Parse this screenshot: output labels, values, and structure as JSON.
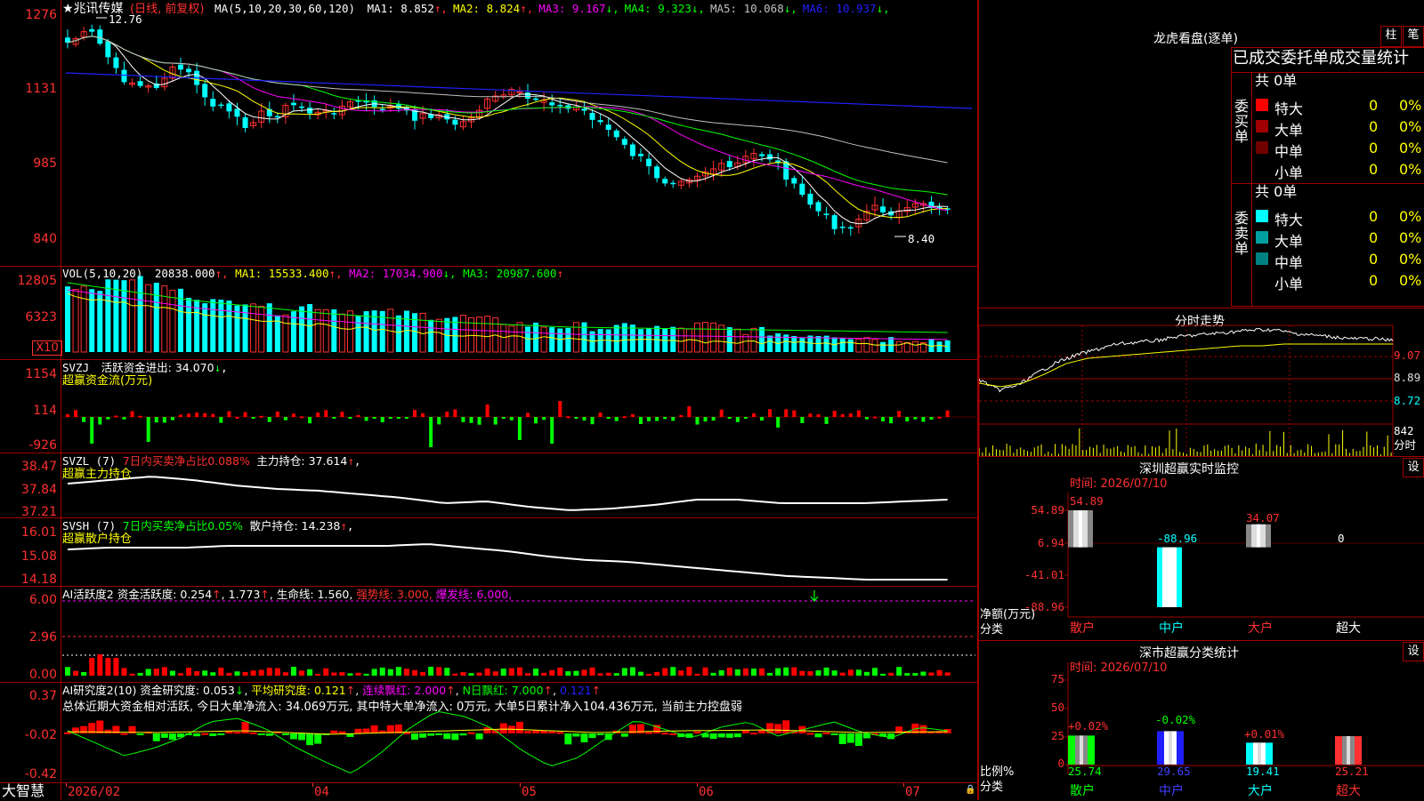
{
  "main": {
    "title": "★兆讯传媒",
    "mode": "(日线, 前复权)",
    "ma_label": "MA(5,10,20,30,60,120)",
    "ma_values": [
      {
        "label": "MA1:",
        "value": "8.852",
        "arrow": "↑",
        "color": "#ffffff"
      },
      {
        "label": "MA2:",
        "value": "8.824",
        "arrow": "↑",
        "color": "#ffff00"
      },
      {
        "label": "MA3:",
        "value": "9.167",
        "arrow": "↓",
        "color": "#ff00ff"
      },
      {
        "label": "MA4:",
        "value": "9.323",
        "arrow": "↓",
        "color": "#00ff00"
      },
      {
        "label": "MA5:",
        "value": "10.068",
        "arrow": "↓",
        "color": "#c0c0c0"
      },
      {
        "label": "MA6:",
        "value": "10.937",
        "arrow": "↓",
        "color": "#2020ff"
      }
    ],
    "yaxis": [
      "1276",
      "1131",
      "985",
      "840"
    ],
    "high_label": "12.76",
    "low_label": "8.40"
  },
  "vol": {
    "title": "VOL(5,10,20)",
    "value": "20838.000",
    "ma1": "MA1: 15533.400",
    "ma2": "MA2: 17034.900",
    "ma3": "MA3: 20987.600",
    "yaxis": [
      "12805",
      "6323"
    ],
    "unit": "X10"
  },
  "svzj": {
    "title": "SVZJ",
    "line": "活跃资金进出: 34.070",
    "sub": "超赢资金流(万元)",
    "yaxis": [
      "1154",
      "114",
      "-926"
    ]
  },
  "svzl": {
    "title": "SVZL (7)",
    "ratio": "7日内买卖净占比0.088%",
    "hold": "主力持仓: 37.614",
    "sub": "超赢主力持仓",
    "yaxis": [
      "38.47",
      "37.84",
      "37.21"
    ]
  },
  "svsh": {
    "title": "SVSH (7)",
    "ratio": "7日内买卖净占比0.05%",
    "hold": "散户持仓: 14.238",
    "sub": "超赢散户持仓",
    "yaxis": [
      "16.01",
      "15.08",
      "14.18"
    ]
  },
  "ai1": {
    "title": "AI活跃度2",
    "v1": "资金活跃度: 0.254",
    "v2": "1.773",
    "v3": "生命线: 1.560",
    "v4": "强势线: 3.000",
    "v5": "爆发线: 6.000",
    "yaxis": [
      "6.00",
      "2.96",
      "0.00"
    ]
  },
  "ai2": {
    "title": "AI研究度2(10)",
    "v1": "资金研究度: 0.053",
    "v2": "平均研究度: 0.121",
    "v3": "连续飘红: 2.000",
    "v4": "N日飘红: 7.000",
    "v5": "0.121",
    "summary": "总体近期大资金相对活跃, 今日大单净流入: 34.069万元, 其中特大单净流入: 0万元, 大单5日累计净入104.436万元, 当前主力控盘弱",
    "yaxis": [
      "0.37",
      "-0.02",
      "-0.42"
    ]
  },
  "dates": {
    "brand": "大智慧",
    "labels": [
      "2026/02",
      "04",
      "05",
      "06",
      "07"
    ]
  },
  "lhb": {
    "title": "龙虎看盘(逐单)",
    "btn1": "柱",
    "btn2": "笔",
    "header": "已成交委托单成交量统计",
    "buy_label": "委买单",
    "sell_label": "委卖单",
    "buy_total": "共 0单",
    "sell_total": "共 0单",
    "buy_rows": [
      {
        "name": "特大",
        "n": "0",
        "pct": "0%",
        "color": "#ff0000"
      },
      {
        "name": "大单",
        "n": "0",
        "pct": "0%",
        "color": "#a00000"
      },
      {
        "name": "中单",
        "n": "0",
        "pct": "0%",
        "color": "#700000"
      },
      {
        "name": "小单",
        "n": "0",
        "pct": "0%",
        "color": "#000000"
      }
    ],
    "sell_rows": [
      {
        "name": "特大",
        "n": "0",
        "pct": "0%",
        "color": "#00ffff"
      },
      {
        "name": "大单",
        "n": "0",
        "pct": "0%",
        "color": "#00a0a0"
      },
      {
        "name": "中单",
        "n": "0",
        "pct": "0%",
        "color": "#008080"
      },
      {
        "name": "小单",
        "n": "0",
        "pct": "0%",
        "color": "#000000"
      }
    ]
  },
  "intraday": {
    "title": "分时走势",
    "yaxis": [
      "9.07",
      "8.89",
      "8.72"
    ],
    "vol_label": "842",
    "vol_unit": "分时"
  },
  "monitor": {
    "title": "深圳超赢实时监控",
    "btn": "设",
    "time": "时间: 2026/07/10",
    "yaxis": [
      "54.89",
      "6.94",
      "-41.01",
      "-88.96"
    ],
    "y_title": "净额(万元)",
    "x_title": "分类",
    "values": [
      "54.89",
      "-88.96",
      "34.07",
      "0"
    ],
    "categories": [
      "散户",
      "中户",
      "大户",
      "超大"
    ]
  },
  "classify": {
    "title": "深市超赢分类统计",
    "btn": "设",
    "time": "时间: 2026/07/10",
    "yaxis": [
      "75",
      "50",
      "25",
      "0"
    ],
    "y_title": "比例%",
    "x_title": "分类",
    "changes": [
      "+0.02%",
      "-0.02%",
      "+0.01%",
      ""
    ],
    "values": [
      "25.74",
      "29.65",
      "19.41",
      "25.21"
    ],
    "categories": [
      "散户",
      "中户",
      "大户",
      "超大"
    ]
  },
  "chart_data": {
    "type": "bar",
    "title": "深圳超赢实时监控",
    "categories": [
      "散户",
      "中户",
      "大户",
      "超大"
    ],
    "series": [
      {
        "name": "净额(万元)",
        "values": [
          54.89,
          -88.96,
          34.07,
          0
        ]
      },
      {
        "name": "比例%",
        "values": [
          25.74,
          29.65,
          19.41,
          25.21
        ]
      }
    ]
  }
}
